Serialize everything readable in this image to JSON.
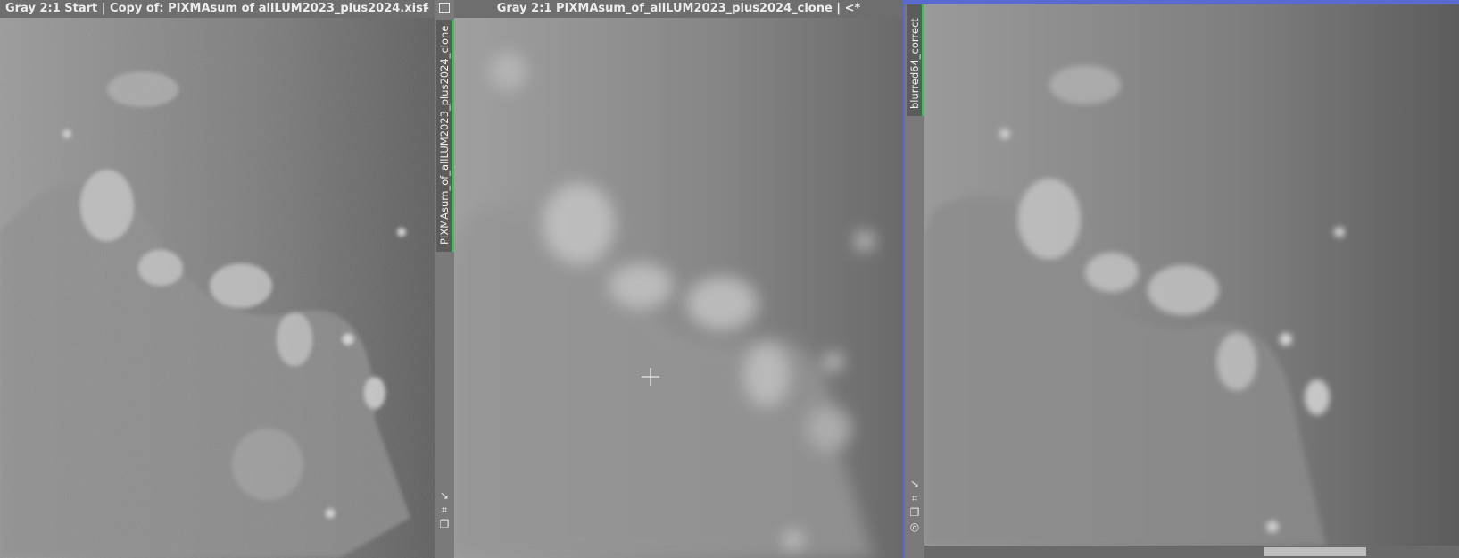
{
  "windows": [
    {
      "title": "Gray 2:1 Start | Copy of: PIXMAsum of allLUM2023_plus2024.xisf",
      "minimize": "–"
    },
    {
      "title": "Gray 2:1 PIXMAsum_of_allLUM2023_plus2024_clone | <*",
      "tab": "PIXMAsum_of_allLUM2023_plus2024_clone"
    },
    {
      "tab": "blurred64_correct"
    }
  ],
  "icons": {
    "restore": "window-restore-icon",
    "arrow": "diagonal-arrow-icon",
    "fit": "fit-view-icon",
    "clone": "clone-icon",
    "target": "target-icon",
    "crosshair": "crosshair-icon"
  },
  "colors": {
    "active_border": "#5a6ad0",
    "tab_accent": "#3fbf5a"
  }
}
